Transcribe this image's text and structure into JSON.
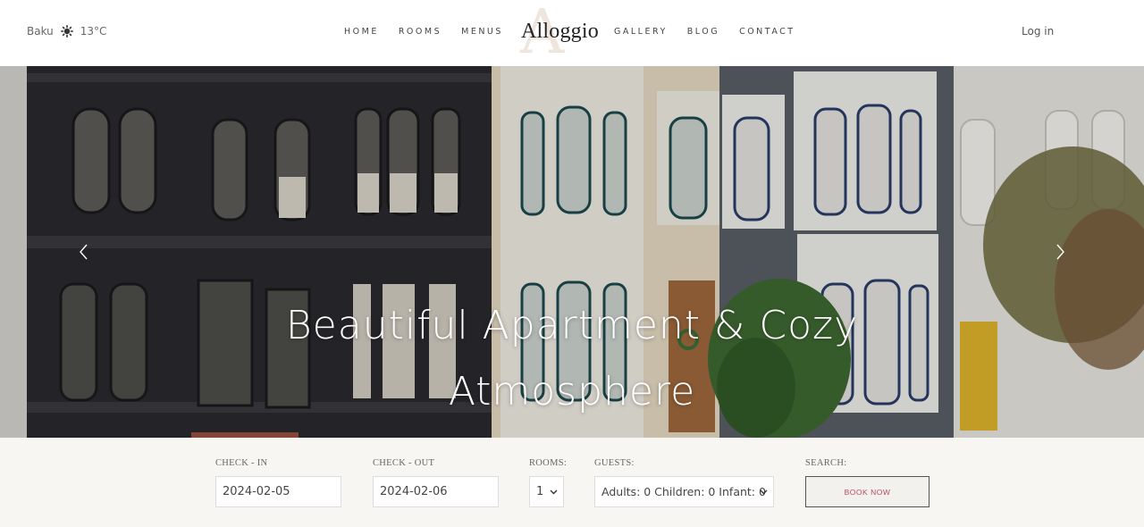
{
  "header": {
    "weather": {
      "city": "Baku",
      "icon": "sun-icon",
      "temperature": "13°C"
    },
    "nav_left": [
      {
        "label": "HOME"
      },
      {
        "label": "ROOMS"
      },
      {
        "label": "MENUS"
      }
    ],
    "nav_right": [
      {
        "label": "GALLERY"
      },
      {
        "label": "BLOG"
      },
      {
        "label": "CONTACT"
      }
    ],
    "logo": {
      "letter": "A",
      "text": "Alloggio"
    },
    "login_label": "Log in"
  },
  "hero": {
    "title_line1": "Beautiful Apartment & Cozy",
    "title_line2": "Atmosphere",
    "prev_icon": "chevron-left-icon",
    "next_icon": "chevron-right-icon"
  },
  "booking": {
    "checkin": {
      "label": "CHECK - IN",
      "value": "2024-02-05"
    },
    "checkout": {
      "label": "CHECK - OUT",
      "value": "2024-02-06"
    },
    "rooms": {
      "label": "ROOMS:",
      "value": "1"
    },
    "guests": {
      "label": "GUESTS:",
      "value": "Adults: 0 Children: 0 Infant: 0"
    },
    "search": {
      "label": "SEARCH:",
      "button": "BOOK NOW"
    }
  },
  "colors": {
    "accent": "#b34a5a",
    "booking_bg": "#f8f6f2"
  }
}
